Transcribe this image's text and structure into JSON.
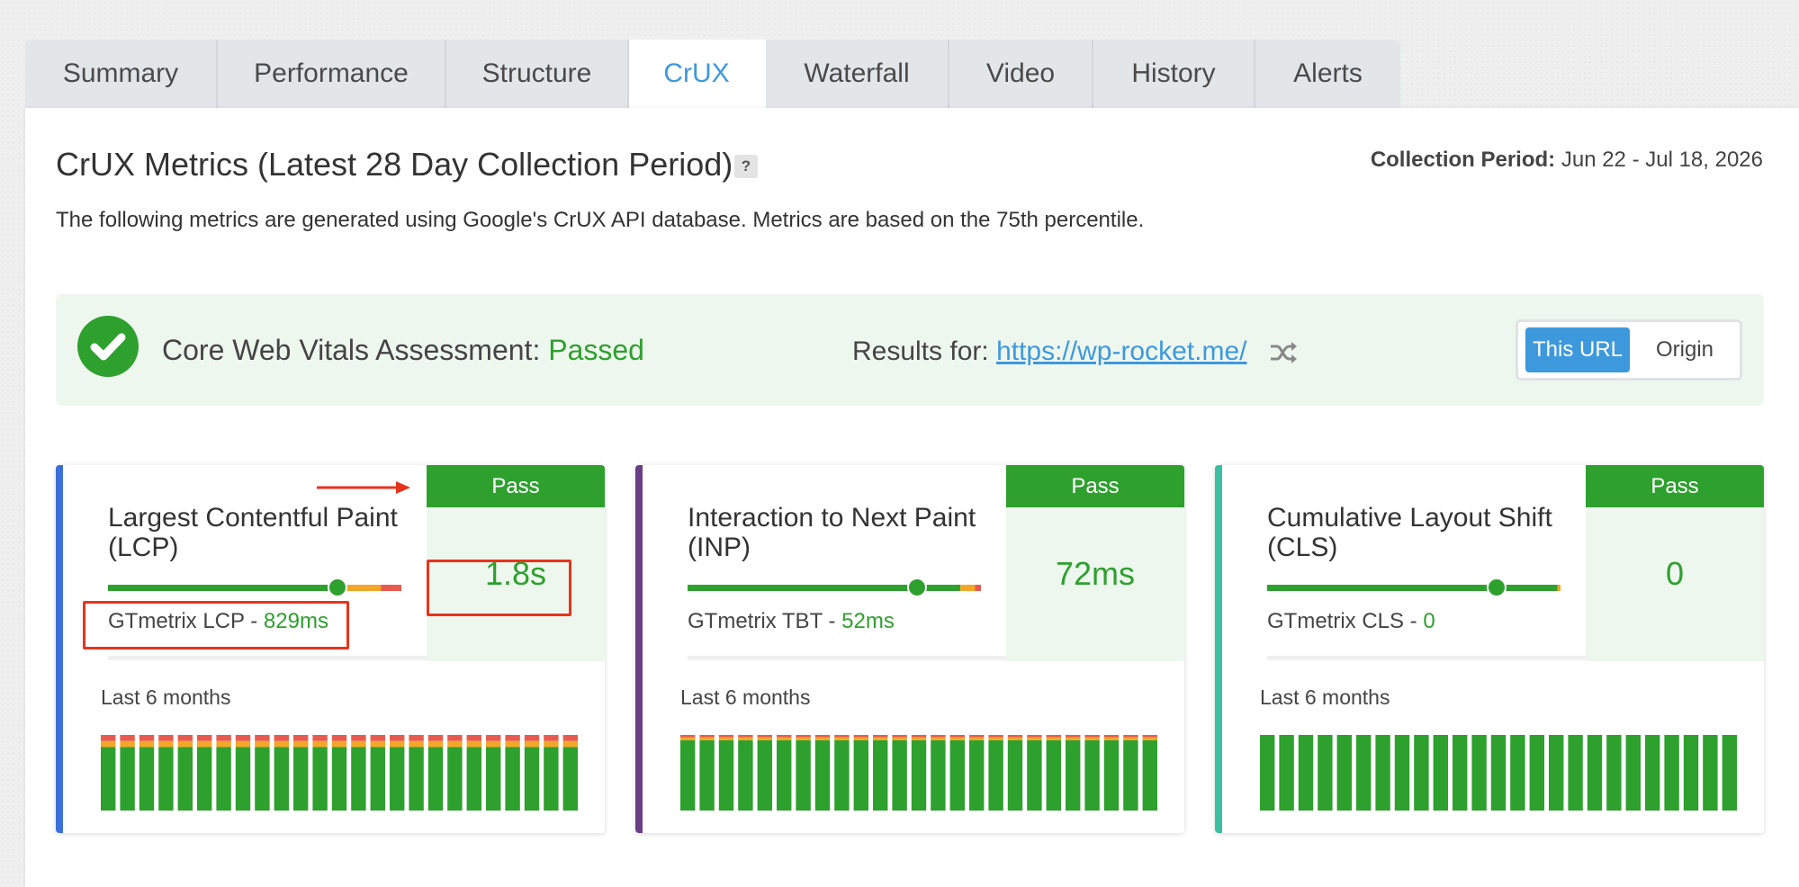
{
  "tabs": [
    "Summary",
    "Performance",
    "Structure",
    "CrUX",
    "Waterfall",
    "Video",
    "History",
    "Alerts"
  ],
  "active_tab": "CrUX",
  "header": {
    "title": "CrUX Metrics (Latest 28 Day Collection Period)",
    "help": "?",
    "period_label": "Collection Period:",
    "period_value": "Jun 22 - Jul 18, 2026",
    "description": "The following metrics are generated using Google's CrUX API database. Metrics are based on the 75th percentile."
  },
  "assessment": {
    "label": "Core Web Vitals Assessment:",
    "status": "Passed",
    "results_for_label": "Results for:",
    "url": "https://wp-rocket.me/",
    "toggle": {
      "selected": "This URL",
      "other": "Origin"
    }
  },
  "colors": {
    "good": "#2ea02e",
    "needs_improvement": "#f4a628",
    "poor": "#e85a4f",
    "accent_blue": "#3d99dc",
    "lcp_accent": "#3d6fd8",
    "inp_accent": "#6a3f86",
    "cls_accent": "#3cbfa0",
    "annotation_red": "#e8331c"
  },
  "icons": {
    "check": "check-circle-icon",
    "shuffle": "shuffle-icon"
  },
  "cards": [
    {
      "id": "lcp",
      "name": "Largest Contentful Paint (LCP)",
      "badge": "Pass",
      "value": "1.8s",
      "gt_label": "GTmetrix LCP -",
      "gt_value": "829ms",
      "months_label": "Last 6 months",
      "distribution": {
        "good": 0.79,
        "needs_improvement": 0.14,
        "poor": 0.07
      },
      "marker": 0.79,
      "history": {
        "bars": 25,
        "good": 0.84,
        "needs_improvement": 0.08,
        "poor": 0.08
      },
      "accent": "#3d6fd8"
    },
    {
      "id": "inp",
      "name": "Interaction to Next Paint (INP)",
      "badge": "Pass",
      "value": "72ms",
      "gt_label": "GTmetrix TBT -",
      "gt_value": "52ms",
      "months_label": "Last 6 months",
      "distribution": {
        "good": 0.93,
        "needs_improvement": 0.05,
        "poor": 0.02
      },
      "marker": 0.79,
      "history": {
        "bars": 25,
        "good": 0.93,
        "needs_improvement": 0.04,
        "poor": 0.03
      },
      "accent": "#6a3f86"
    },
    {
      "id": "cls",
      "name": "Cumulative Layout Shift (CLS)",
      "badge": "Pass",
      "value": "0",
      "gt_label": "GTmetrix CLS -",
      "gt_value": "0",
      "months_label": "Last 6 months",
      "distribution": {
        "good": 0.99,
        "needs_improvement": 0.01,
        "poor": 0
      },
      "marker": 0.79,
      "history": {
        "bars": 25,
        "good": 1.0,
        "needs_improvement": 0,
        "poor": 0
      },
      "accent": "#3cbfa0"
    }
  ]
}
